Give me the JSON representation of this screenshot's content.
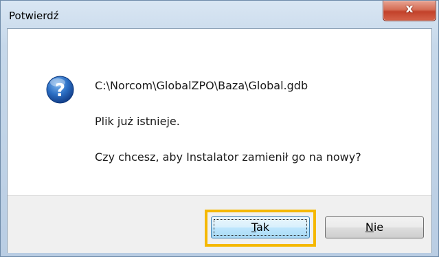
{
  "window": {
    "title": "Potwierdź",
    "close_glyph": "x"
  },
  "message": {
    "icon": "question-icon",
    "path": "C:\\Norcom\\GlobalZPO\\Baza\\Global.gdb",
    "line1": "Plik już istnieje.",
    "line2": "Czy chcesz, aby Instalator zamienił go na nowy?"
  },
  "buttons": {
    "yes_accel": "T",
    "yes_rest": "ak",
    "no_accel": "N",
    "no_rest": "ie"
  },
  "colors": {
    "highlight": "#f5b800",
    "close_red": "#c2412a",
    "icon_blue": "#1f5fb5"
  }
}
